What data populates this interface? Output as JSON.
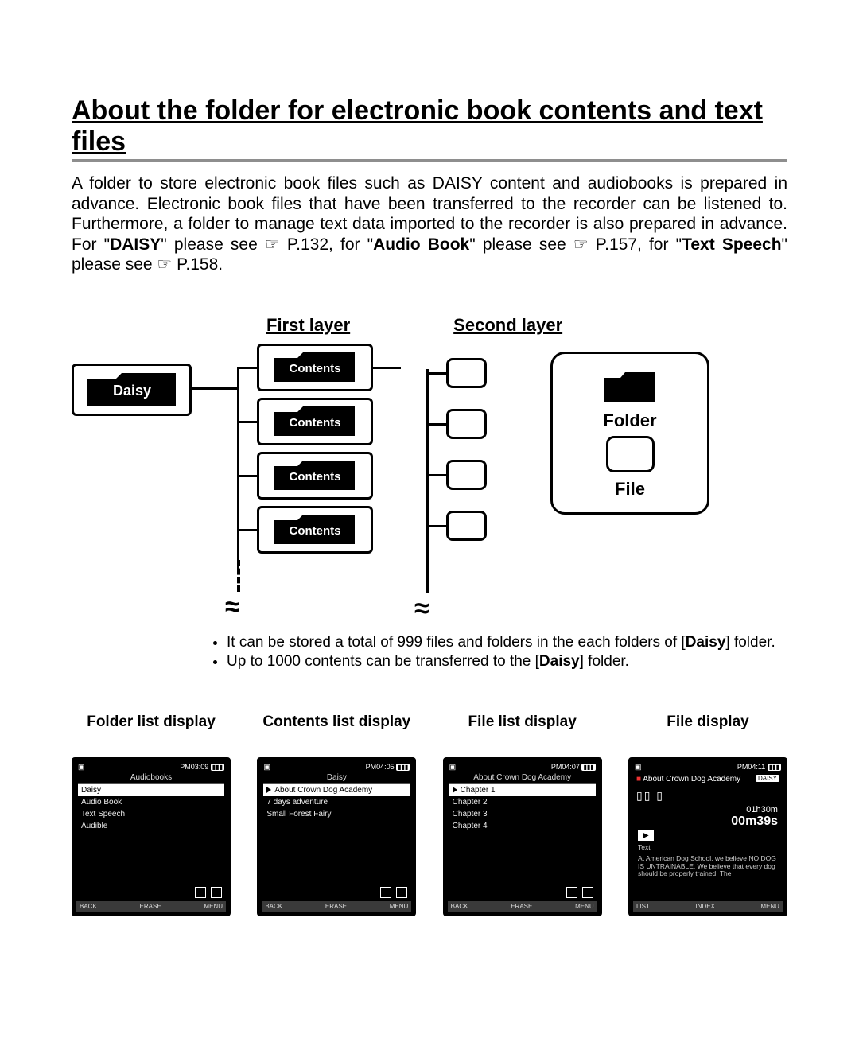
{
  "title": "About the folder for electronic book contents and text files",
  "intro": {
    "p1": "A folder to store electronic book files such as DAISY content and audiobooks is prepared in advance. Electronic book files that have been transferred to the recorder can be listened to. Furthermore, a folder to manage text data imported to the recorder is also prepared in advance.",
    "for_prefix": "For \"",
    "daisy": "DAISY",
    "daisy_ref": "\" please see ☞ P.132, for \"",
    "audio_book": "Audio Book",
    "audio_ref": "\" please see ☞ P.157, for \"",
    "text_speech": "Text Speech",
    "text_ref": "\" please see ☞ P.158."
  },
  "layers": {
    "first": "First layer",
    "second": "Second layer"
  },
  "folders": {
    "root": "Daisy",
    "contents_items": [
      "Contents",
      "Contents",
      "Contents",
      "Contents"
    ]
  },
  "legend": {
    "folder": "Folder",
    "file": "File"
  },
  "notes": [
    "It can be stored a total of 999 files and folders in the each folders of [Daisy] folder.",
    "Up to 1000 contents can be transferred to the [Daisy] folder."
  ],
  "notes_bold_word": "Daisy",
  "displays": {
    "folder_list": {
      "title": "Folder list display",
      "status_time": "PM03:09",
      "battery": "▮▮▮",
      "heading": "Audiobooks",
      "rows": [
        "Daisy",
        "Audio Book",
        "Text Speech",
        "Audible"
      ],
      "bottom": [
        "BACK",
        "ERASE",
        "MENU"
      ]
    },
    "contents_list": {
      "title": "Contents list display",
      "status_time": "PM04:05",
      "battery": "▮▮▮",
      "heading": "Daisy",
      "rows": [
        "About Crown Dog Academy",
        "7 days adventure",
        "Small Forest Fairy"
      ],
      "bottom": [
        "BACK",
        "ERASE",
        "MENU"
      ]
    },
    "file_list": {
      "title": "File list display",
      "status_time": "PM04:07",
      "battery": "▮▮▮",
      "heading": "About Crown Dog Academy",
      "rows": [
        "Chapter 1",
        "Chapter 2",
        "Chapter 3",
        "Chapter 4"
      ],
      "bottom": [
        "BACK",
        "ERASE",
        "MENU"
      ]
    },
    "file_display": {
      "title": "File display",
      "status_time": "PM04:11",
      "battery": "▮▮▮",
      "play_title": "About Crown Dog Academy",
      "tag": "DAISY",
      "time_total": "01h30m",
      "time_elapsed": "00m39s",
      "text_label": "Text",
      "text_body": "At American Dog School, we believe NO DOG IS UNTRAINABLE. We believe that every dog should be properly trained. The",
      "bottom": [
        "LIST",
        "INDEX",
        "MENU"
      ]
    }
  }
}
